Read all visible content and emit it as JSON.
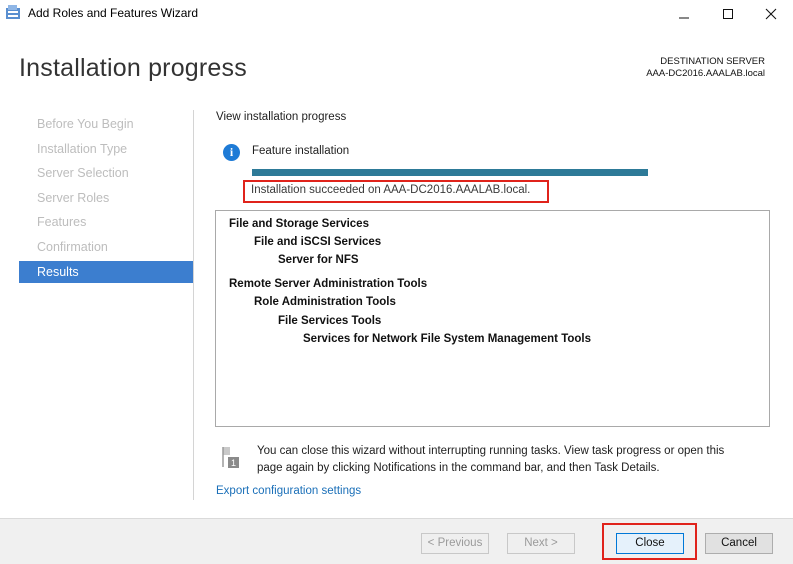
{
  "window": {
    "title": "Add Roles and Features Wizard",
    "app_icon": "server-manager-icon",
    "controls": {
      "minimize": "minimize-icon",
      "maximize": "maximize-icon",
      "close": "close-icon"
    }
  },
  "header": {
    "title": "Installation progress",
    "destination_label": "DESTINATION SERVER",
    "destination_server": "AAA-DC2016.AAALAB.local"
  },
  "nav": {
    "items": [
      {
        "label": "Before You Begin",
        "active": false
      },
      {
        "label": "Installation Type",
        "active": false
      },
      {
        "label": "Server Selection",
        "active": false
      },
      {
        "label": "Server Roles",
        "active": false
      },
      {
        "label": "Features",
        "active": false
      },
      {
        "label": "Confirmation",
        "active": false
      },
      {
        "label": "Results",
        "active": true
      }
    ]
  },
  "main": {
    "view_label": "View installation progress",
    "feature_label": "Feature installation",
    "progress_fraction": 1.0,
    "status_text": "Installation succeeded on AAA-DC2016.AAALAB.local.",
    "results": [
      {
        "text": "File and Storage Services",
        "level": 0
      },
      {
        "text": "File and iSCSI Services",
        "level": 1
      },
      {
        "text": "Server for NFS",
        "level": 2
      },
      {
        "text": "Remote Server Administration Tools",
        "level": 0
      },
      {
        "text": "Role Administration Tools",
        "level": 1
      },
      {
        "text": "File Services Tools",
        "level": 2
      },
      {
        "text": "Services for Network File System Management Tools",
        "level": 3
      }
    ],
    "note_line1": "You can close this wizard without interrupting running tasks. View task progress or open this",
    "note_line2": "page again by clicking Notifications in the command bar, and then Task Details.",
    "export_link": "Export configuration settings"
  },
  "footer": {
    "previous_label": "< Previous",
    "next_label": "Next >",
    "close_label": "Close",
    "cancel_label": "Cancel"
  },
  "colors": {
    "accent": "#3c7ecf",
    "progress": "#2d7a98",
    "highlight": "#e0231b",
    "link": "#1a6fb8"
  }
}
